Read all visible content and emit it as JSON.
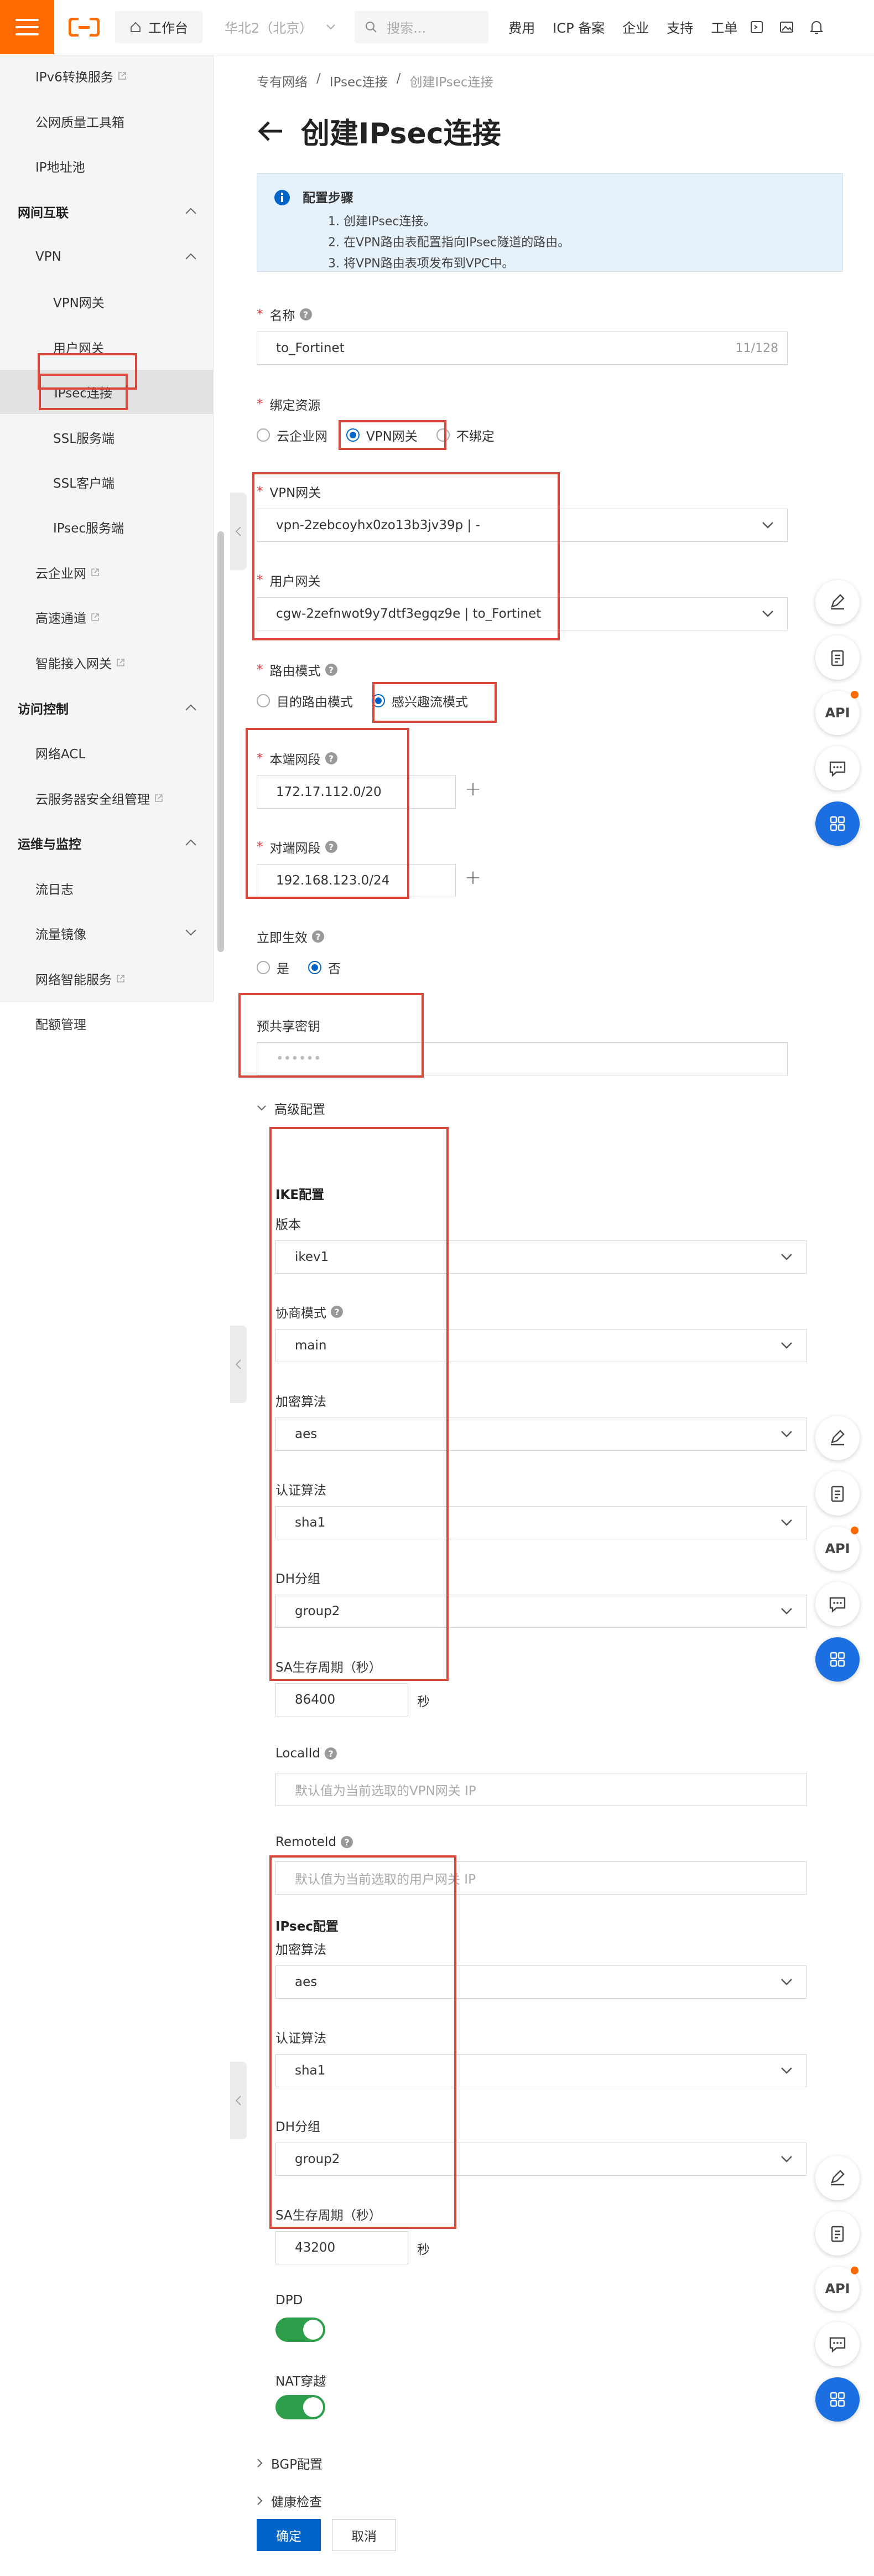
{
  "topbar": {
    "workspace": "工作台",
    "region": "华北2（北京）",
    "search_placeholder": "搜索...",
    "links": [
      "费用",
      "ICP 备案",
      "企业",
      "支持",
      "工单"
    ]
  },
  "sidebar": {
    "items": [
      {
        "label": "IPv6转换服务",
        "level": "l1",
        "ext": true
      },
      {
        "label": "公网质量工具箱",
        "level": "l1"
      },
      {
        "label": "IP地址池",
        "level": "l1"
      },
      {
        "label": "网间互联",
        "level": "group",
        "chev": "up"
      },
      {
        "label": "VPN",
        "level": "l1",
        "chev": "up"
      },
      {
        "label": "VPN网关",
        "level": "l2"
      },
      {
        "label": "用户网关",
        "level": "l2"
      },
      {
        "label": "IPsec连接",
        "level": "l2",
        "active": true
      },
      {
        "label": "SSL服务端",
        "level": "l2"
      },
      {
        "label": "SSL客户端",
        "level": "l2"
      },
      {
        "label": "IPsec服务端",
        "level": "l2"
      },
      {
        "label": "云企业网",
        "level": "l1",
        "ext": true
      },
      {
        "label": "高速通道",
        "level": "l1",
        "ext": true
      },
      {
        "label": "智能接入网关",
        "level": "l1",
        "ext": true
      },
      {
        "label": "访问控制",
        "level": "group",
        "chev": "up"
      },
      {
        "label": "网络ACL",
        "level": "l1"
      },
      {
        "label": "云服务器安全组管理",
        "level": "l1",
        "ext": true
      },
      {
        "label": "运维与监控",
        "level": "group",
        "chev": "up"
      },
      {
        "label": "流日志",
        "level": "l1"
      },
      {
        "label": "流量镜像",
        "level": "l1",
        "chev": "down"
      },
      {
        "label": "网络智能服务",
        "level": "l1",
        "ext": true
      },
      {
        "label": "配额管理",
        "level": "l1"
      }
    ]
  },
  "breadcrumb": [
    "专有网络",
    "/",
    "IPsec连接",
    "/",
    "创建IPsec连接"
  ],
  "page_title": "创建IPsec连接",
  "info": {
    "title": "配置步骤",
    "steps": [
      "1. 创建IPsec连接。",
      "2. 在VPN路由表配置指向IPsec隧道的路由。",
      "3. 将VPN路由表项发布到VPC中。"
    ]
  },
  "form": {
    "name_label": "名称",
    "name_value": "to_Fortinet",
    "name_counter": "11/128",
    "bind_label": "绑定资源",
    "bind_options": [
      "云企业网",
      "VPN网关",
      "不绑定"
    ],
    "bind_selected": 1,
    "vpn_gw_label": "VPN网关",
    "vpn_gw_value": "vpn-2zebcoyhx0zo13b3jv39p | -",
    "cgw_label": "用户网关",
    "cgw_value": "cgw-2zefnwot9y7dtf3egqz9e | to_Fortinet",
    "route_mode_label": "路由模式",
    "route_mode_options": [
      "目的路由模式",
      "感兴趣流模式"
    ],
    "route_mode_selected": 1,
    "local_cidr_label": "本端网段",
    "local_cidr_value": "172.17.112.0/20",
    "remote_cidr_label": "对端网段",
    "remote_cidr_value": "192.168.123.0/24",
    "effect_label": "立即生效",
    "effect_options": [
      "是",
      "否"
    ],
    "effect_selected": 1,
    "psk_label": "预共享密钥",
    "psk_value": "••••••",
    "advanced_label": "高级配置"
  },
  "ike": {
    "title": "IKE配置",
    "version_label": "版本",
    "version_value": "ikev1",
    "mode_label": "协商模式",
    "mode_value": "main",
    "enc_label": "加密算法",
    "enc_value": "aes",
    "auth_label": "认证算法",
    "auth_value": "sha1",
    "dh_label": "DH分组",
    "dh_value": "group2",
    "sa_label": "SA生存周期（秒）",
    "sa_value": "86400",
    "sa_unit": "秒",
    "localid_label": "LocalId",
    "localid_placeholder": "默认值为当前选取的VPN网关 IP",
    "remoteid_label": "RemoteId",
    "remoteid_placeholder": "默认值为当前选取的用户网关 IP"
  },
  "ipsec": {
    "title": "IPsec配置",
    "enc_label": "加密算法",
    "enc_value": "aes",
    "auth_label": "认证算法",
    "auth_value": "sha1",
    "dh_label": "DH分组",
    "dh_value": "group2",
    "sa_label": "SA生存周期（秒）",
    "sa_value": "43200",
    "sa_unit": "秒",
    "dpd_label": "DPD",
    "dpd_on": true,
    "nat_label": "NAT穿越",
    "nat_on": true
  },
  "collapsed": {
    "bgp": "BGP配置",
    "health": "健康检查"
  },
  "actions": {
    "ok": "确定",
    "cancel": "取消"
  },
  "tools": {
    "api_label": "API"
  },
  "colors": {
    "brand": "#ff6a00",
    "primary": "#0064c8",
    "annotation": "#d9473a",
    "switch_on": "#2d9e49"
  }
}
